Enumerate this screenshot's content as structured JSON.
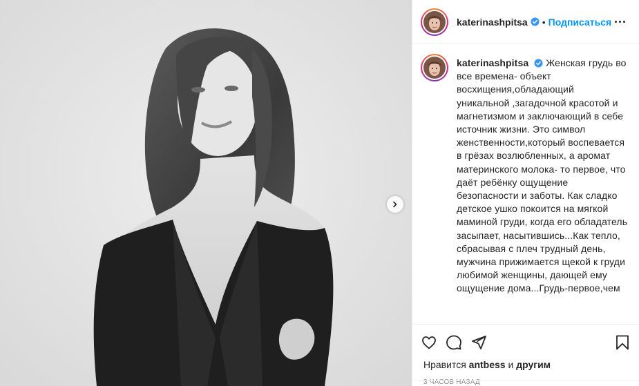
{
  "author": {
    "username": "katerinashpitsa",
    "verified": true,
    "follow_label": "Подписаться",
    "separator": "•"
  },
  "media": {
    "alt_desc_icon": "photo",
    "has_next": true
  },
  "caption": {
    "text": "Женская грудь во все времена- объект восхищения,обладающий уникальной ,загадочной красотой и магнетизмом и заключающий в себе источник жизни. Это символ женственности,который воспевается в грёзах возлюбленных, а аромат материнского молока- то первое, что даёт ребёнку ощущение безопасности и заботы. Как сладко детское ушко покоится на мягкой маминой груди, когда его обладатель засыпает, насытившись...Как тепло, сбрасывая с плеч трудный день, мужчина прижимается щекой к груди любимой женщины, дающей ему ощущение дома...Грудь-первое,чем"
  },
  "likes": {
    "prefix": "Нравится",
    "user": "antbess",
    "conj": "и",
    "others": "другим"
  },
  "timestamp": "3 часов назад",
  "colors": {
    "link_blue": "#0095f6",
    "text": "#262626",
    "muted": "#8e8e8e",
    "verified_blue": "#3897f0"
  },
  "icons": [
    "heart-icon",
    "comment-icon",
    "share-icon",
    "bookmark-icon",
    "chevron-right-icon",
    "verified-badge-icon",
    "more-icon"
  ]
}
